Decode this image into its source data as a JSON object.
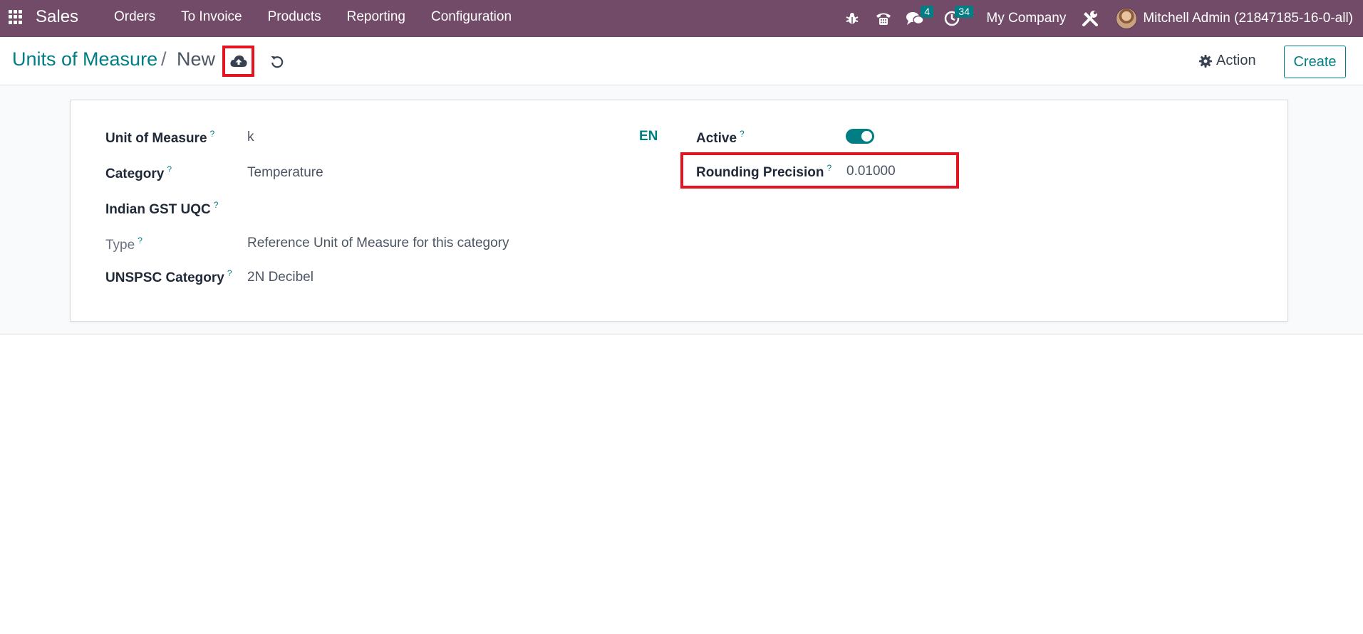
{
  "navbar": {
    "brand": "Sales",
    "menu": [
      "Orders",
      "To Invoice",
      "Products",
      "Reporting",
      "Configuration"
    ],
    "messages_count": "4",
    "activities_count": "34",
    "company": "My Company",
    "user": "Mitchell Admin (21847185-16-0-all)",
    "colors": {
      "background": "#714b67",
      "badge": "#017e84"
    }
  },
  "control_panel": {
    "breadcrumb_parent": "Units of Measure",
    "breadcrumb_separator": "/",
    "breadcrumb_current": "New",
    "action_label": "Action",
    "create_label": "Create"
  },
  "form": {
    "uom_label": "Unit of Measure",
    "uom_value": "k",
    "lang": "EN",
    "category_label": "Category",
    "category_value": "Temperature",
    "gst_label": "Indian GST UQC",
    "gst_value": "",
    "type_label": "Type",
    "type_value": "Reference Unit of Measure for this category",
    "unspsc_label": "UNSPSC Category",
    "unspsc_value": "2N Decibel",
    "active_label": "Active",
    "active_value": true,
    "rounding_label": "Rounding Precision",
    "rounding_value": "0.01000",
    "help_mark": "?"
  },
  "annotations": {
    "highlight_color": "#e3141f"
  }
}
